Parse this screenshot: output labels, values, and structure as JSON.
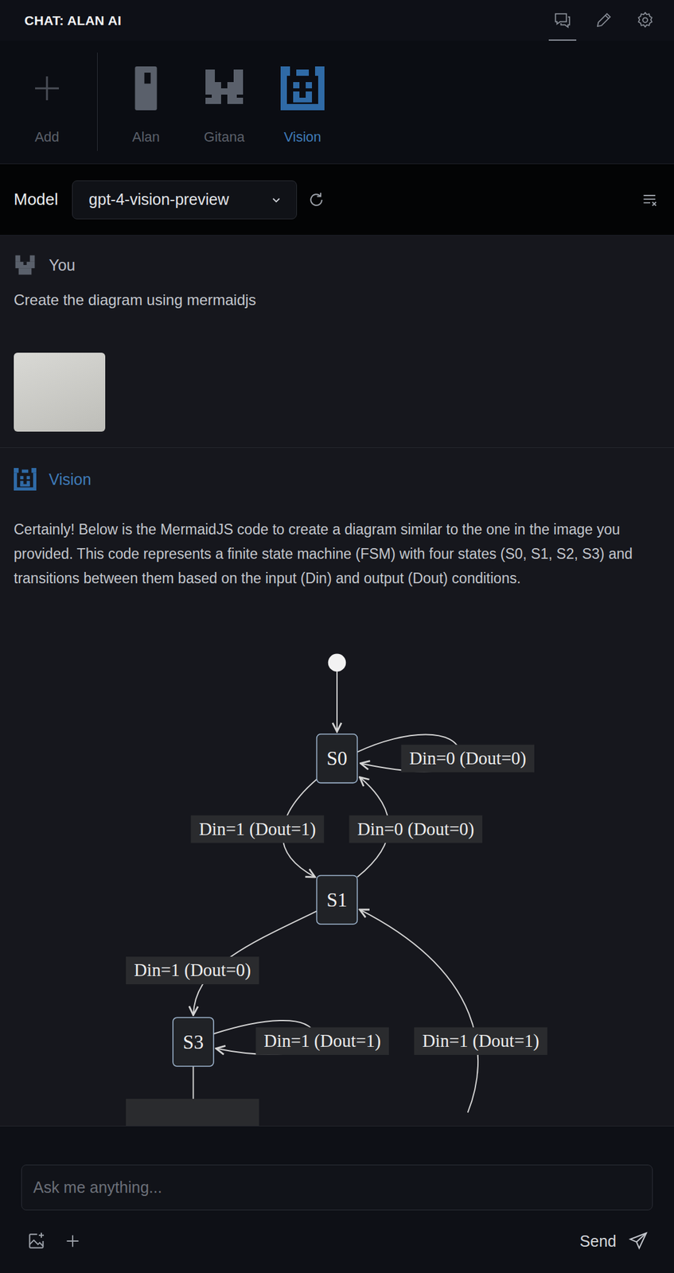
{
  "window": {
    "title": "CHAT: ALAN AI"
  },
  "toolbar_icons": [
    {
      "kind": "chat",
      "selected": true
    },
    {
      "kind": "edit",
      "selected": false
    },
    {
      "kind": "settings",
      "selected": false
    }
  ],
  "agents": {
    "add_label": "Add",
    "items": [
      {
        "label": "Alan",
        "kind": "alan",
        "selected": false
      },
      {
        "label": "Gitana",
        "kind": "gitana",
        "selected": false
      },
      {
        "label": "Vision",
        "kind": "vision",
        "selected": true
      }
    ]
  },
  "model": {
    "label": "Model",
    "value": "gpt-4-vision-preview"
  },
  "messages": [
    {
      "author": "You",
      "kind": "user",
      "text": "Create the diagram using mermaidjs",
      "has_image": true
    },
    {
      "author": "Vision",
      "kind": "assistant",
      "text": "Certainly! Below is the MermaidJS code to create a diagram similar to the one in the image you provided. This code represents a finite state machine (FSM) with four states (S0, S1, S2, S3) and transitions between them based on the input (Din) and output (Dout) conditions.",
      "diagram": {
        "has_start": true,
        "nodes": [
          {
            "label": "S0"
          },
          {
            "label": "S1"
          },
          {
            "label": "S3"
          }
        ],
        "edges": [
          {
            "from": 0,
            "to": 0,
            "label": "Din=0 (Dout=0)"
          },
          {
            "from": 0,
            "to": 1,
            "label": "Din=1 (Dout=1)"
          },
          {
            "from": 1,
            "to": 0,
            "label": "Din=0 (Dout=0)"
          },
          {
            "from": 1,
            "to": 2,
            "label": "Din=1 (Dout=0)"
          },
          {
            "from": 2,
            "to": 2,
            "label": "Din=1 (Dout=1)"
          },
          {
            "from": null,
            "to": 1,
            "label": "Din=1 (Dout=1)"
          },
          {
            "from": 2,
            "to": null,
            "label": ""
          }
        ]
      }
    }
  ],
  "input": {
    "placeholder": "Ask me anything...",
    "send_label": "Send"
  }
}
